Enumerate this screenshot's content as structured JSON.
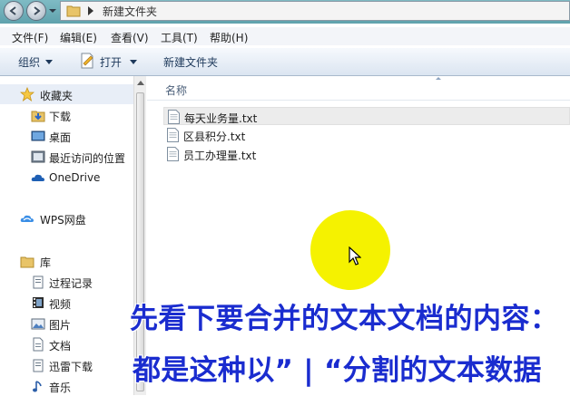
{
  "address": {
    "path": "新建文件夹"
  },
  "menu": [
    "文件(F)",
    "编辑(E)",
    "查看(V)",
    "工具(T)",
    "帮助(H)"
  ],
  "toolbar": {
    "organize": "组织",
    "open": "打开",
    "new_folder": "新建文件夹"
  },
  "sidebar": {
    "favorites": "收藏夹",
    "fav_items": [
      "下载",
      "桌面",
      "最近访问的位置"
    ],
    "onedrive": "OneDrive",
    "wps": "WPS网盘",
    "library": "库",
    "lib_items": [
      "过程记录",
      "视频",
      "图片",
      "文档",
      "迅雷下载",
      "音乐"
    ]
  },
  "content": {
    "column_name": "名称",
    "files": [
      "每天业务量.txt",
      "区县积分.txt",
      "员工办理量.txt"
    ]
  },
  "caption": {
    "line1": "先看下要合并的文本文档的内容：",
    "line2": "都是这种以” | “分割的文本数据"
  },
  "colors": {
    "highlight": "#f5f200",
    "caption": "#1a2ccf"
  }
}
